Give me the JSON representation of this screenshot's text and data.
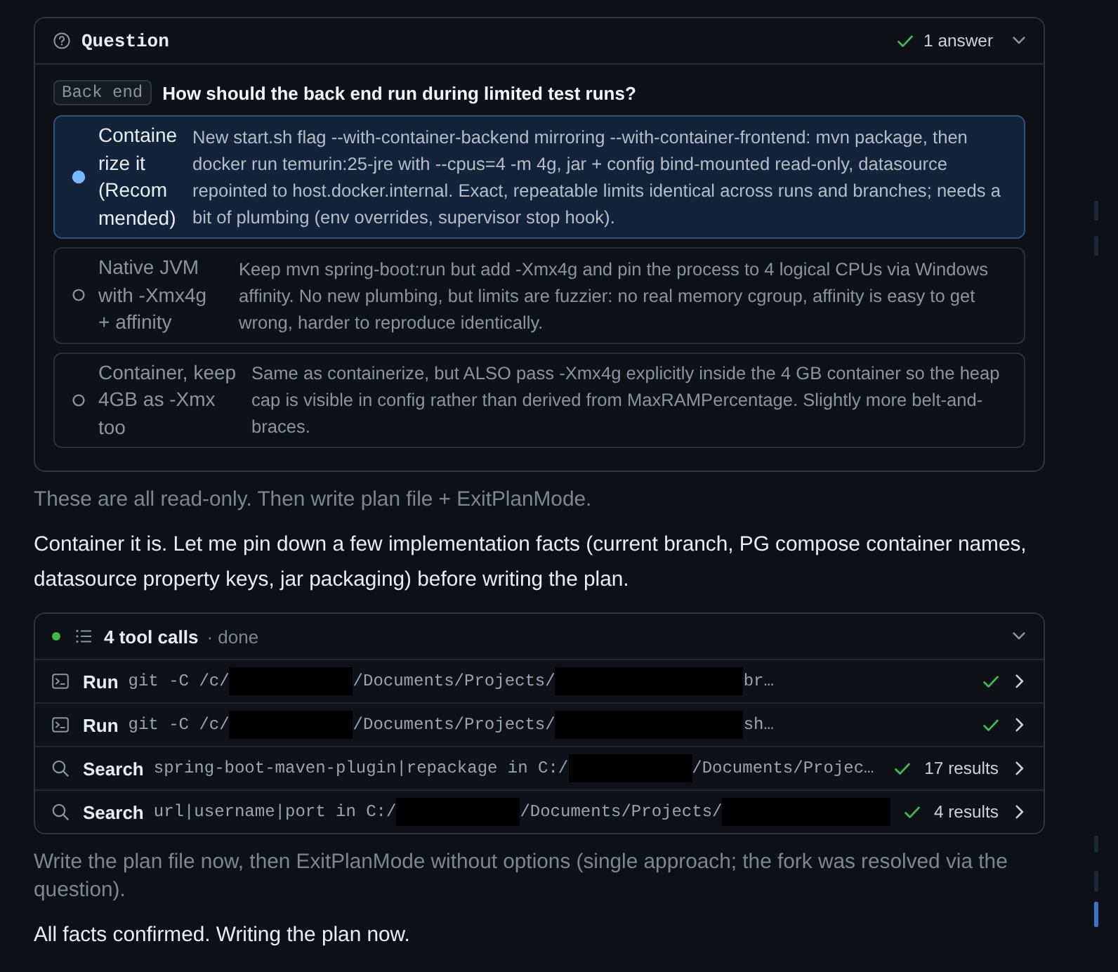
{
  "question": {
    "title": "Question",
    "answer_count": "1 answer",
    "tag": "Back end",
    "prompt": "How should the back end run during limited test runs?",
    "options": [
      {
        "label": "Containerize it (Recommended)",
        "description": "New start.sh flag --with-container-backend mirroring --with-container-frontend: mvn package, then docker run temurin:25-jre with --cpus=4 -m 4g, jar + config bind-mounted read-only, datasource repointed to host.docker.internal. Exact, repeatable limits identical across runs and branches; needs a bit of plumbing (env overrides, supervisor stop hook).",
        "selected": true
      },
      {
        "label": "Native JVM with -Xmx4g + affinity",
        "description": "Keep mvn spring-boot:run but add -Xmx4g and pin the process to 4 logical CPUs via Windows affinity. No new plumbing, but limits are fuzzier: no real memory cgroup, affinity is easy to get wrong, harder to reproduce identically.",
        "selected": false
      },
      {
        "label": "Container, keep 4GB as -Xmx too",
        "description": "Same as containerize, but ALSO pass -Xmx4g explicitly inside the 4 GB container so the heap cap is visible in config rather than derived from MaxRAMPercentage. Slightly more belt-and-braces.",
        "selected": false
      }
    ]
  },
  "messages_before": [
    {
      "kind": "note",
      "text": "These are all read-only. Then write plan file + ExitPlanMode."
    },
    {
      "kind": "reply",
      "text": "Container it is. Let me pin down a few implementation facts (current branch, PG compose container names, datasource property keys, jar packaging) before writing the plan."
    }
  ],
  "tool_calls": {
    "title": "4 tool calls",
    "status": "· done",
    "calls": [
      {
        "kind": "run",
        "verb": "Run",
        "parts": [
          {
            "kind": "text",
            "text": "git -C /c/"
          },
          {
            "kind": "redacted"
          },
          {
            "kind": "text",
            "text": "/Documents/Projects/"
          },
          {
            "kind": "redacted"
          },
          {
            "kind": "text",
            "text": "br…"
          }
        ]
      },
      {
        "kind": "run",
        "verb": "Run",
        "parts": [
          {
            "kind": "text",
            "text": "git -C /c/"
          },
          {
            "kind": "redacted"
          },
          {
            "kind": "text",
            "text": "/Documents/Projects/"
          },
          {
            "kind": "redacted"
          },
          {
            "kind": "text",
            "text": "sh…"
          }
        ]
      },
      {
        "kind": "search",
        "verb": "Search",
        "parts": [
          {
            "kind": "text",
            "text": "spring-boot-maven-plugin|repackage in C:/"
          },
          {
            "kind": "redacted"
          },
          {
            "kind": "text",
            "text": "/Documents/Projec…"
          }
        ],
        "results": "17 results"
      },
      {
        "kind": "search",
        "verb": "Search",
        "parts": [
          {
            "kind": "text",
            "text": "url|username|port in C:/"
          },
          {
            "kind": "redacted"
          },
          {
            "kind": "text",
            "text": "/Documents/Projects/"
          },
          {
            "kind": "redacted"
          }
        ],
        "results": "4 results"
      }
    ]
  },
  "messages_after": [
    {
      "kind": "note",
      "text": "Write the plan file now, then ExitPlanMode without options (single approach; the fork was resolved via the question)."
    },
    {
      "kind": "reply",
      "text": "All facts confirmed. Writing the plan now."
    }
  ]
}
